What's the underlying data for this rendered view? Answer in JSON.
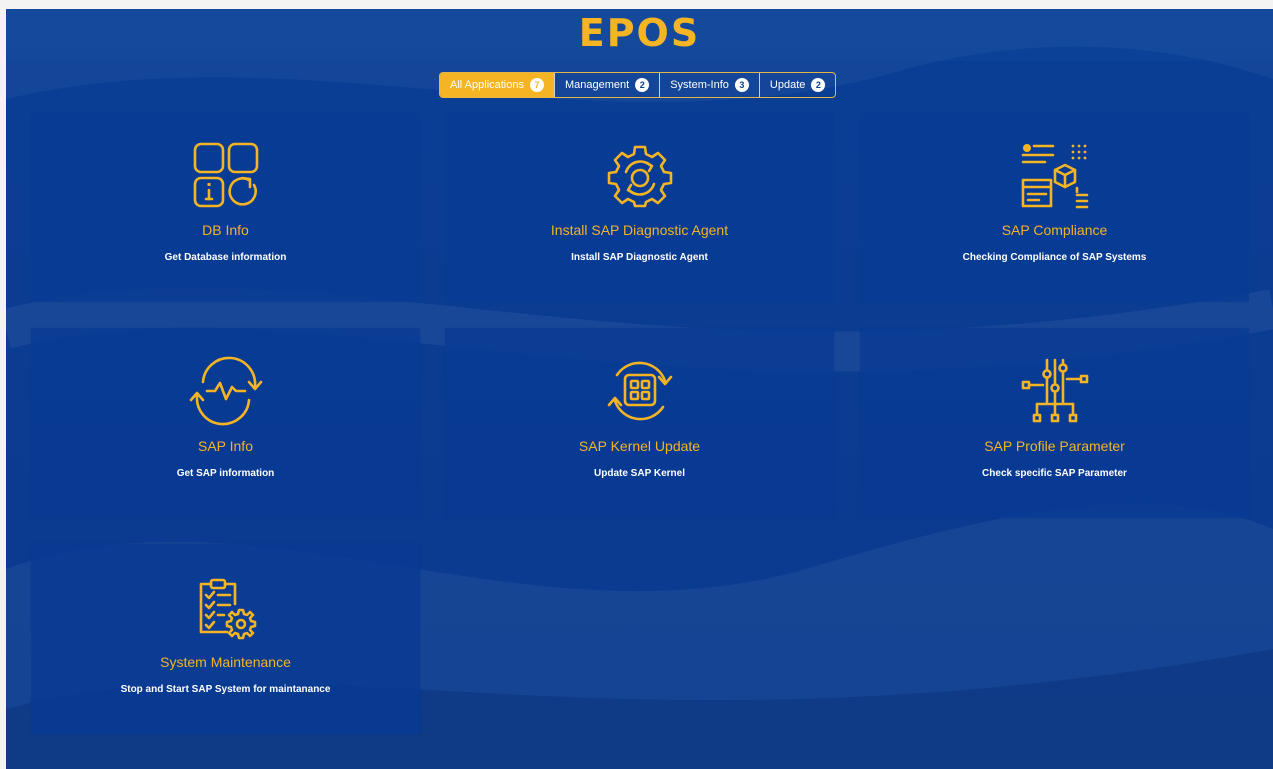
{
  "logo": "EPOS",
  "tabs": [
    {
      "label": "All Applications",
      "count": "7",
      "active": true
    },
    {
      "label": "Management",
      "count": "2",
      "active": false
    },
    {
      "label": "System-Info",
      "count": "3",
      "active": false
    },
    {
      "label": "Update",
      "count": "2",
      "active": false
    }
  ],
  "cards": [
    {
      "title": "DB Info",
      "desc": "Get Database information",
      "icon": "database-info-icon"
    },
    {
      "title": "Install SAP Diagnostic Agent",
      "desc": "Install SAP Diagnostic Agent",
      "icon": "gear-icon"
    },
    {
      "title": "SAP Compliance",
      "desc": "Checking Compliance of SAP Systems",
      "icon": "compliance-icon"
    },
    {
      "title": "SAP Info",
      "desc": "Get SAP information",
      "icon": "pulse-cycle-icon"
    },
    {
      "title": "SAP Kernel Update",
      "desc": "Update SAP Kernel",
      "icon": "chip-refresh-icon"
    },
    {
      "title": "SAP Profile Parameter",
      "desc": "Check specific SAP Parameter",
      "icon": "parameter-sliders-icon"
    },
    {
      "title": "System Maintenance",
      "desc": "Stop and Start SAP System for maintanance",
      "icon": "clipboard-gear-icon"
    }
  ],
  "colors": {
    "accent": "#f5b423",
    "background": "#0a3c92",
    "card": "#093a94",
    "text": "#ffffff"
  }
}
